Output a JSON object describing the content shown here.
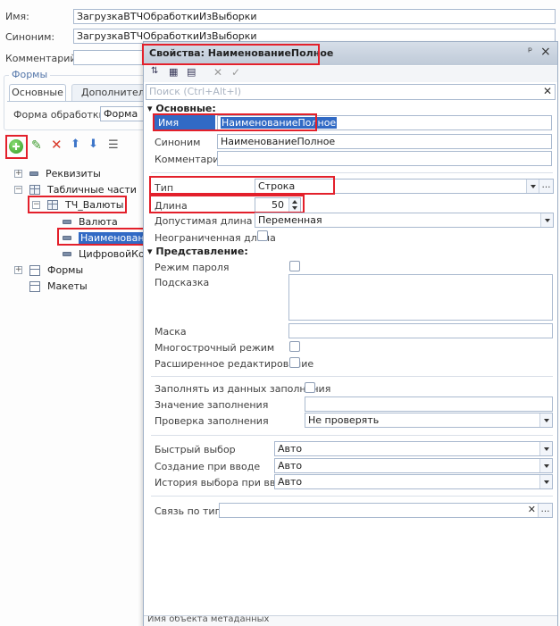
{
  "main_form": {
    "name_label": "Имя:",
    "name_value": "ЗагрузкаВТЧОбработкиИзВыборки",
    "synonym_label": "Синоним:",
    "synonym_value": "ЗагрузкаВТЧОбработкиИзВыборки",
    "comment_label": "Комментарий:",
    "comment_value": "",
    "forms_group_label": "Формы",
    "tabs": [
      {
        "label": "Основные",
        "active": true
      },
      {
        "label": "Дополнитель",
        "active": false
      }
    ],
    "form_label": "Форма обработки:",
    "form_value": "Форма"
  },
  "tree": {
    "items": [
      {
        "label": "Реквизиты",
        "icon": "attribute-icon",
        "expander": "+"
      },
      {
        "label": "Табличные части",
        "icon": "table-icon",
        "expander": "−"
      },
      {
        "label": "ТЧ_Валюты",
        "icon": "table-icon",
        "expander": "−"
      },
      {
        "label": "Валюта",
        "icon": "attribute-icon"
      },
      {
        "label": "Наименование",
        "icon": "attribute-icon",
        "selected": true
      },
      {
        "label": "ЦифровойКод",
        "icon": "attribute-icon"
      },
      {
        "label": "Формы",
        "icon": "form-icon",
        "expander": "+"
      },
      {
        "label": "Макеты",
        "icon": "template-icon"
      }
    ]
  },
  "properties": {
    "title": "Свойства: НаименованиеПолное",
    "pin_glyph": "ᵖ",
    "close_glyph": "×",
    "search_placeholder": "Поиск (Ctrl+Alt+I)",
    "section_main": "Основные:",
    "name_label": "Имя",
    "name_value": "НаименованиеПолное",
    "synonym_label": "Синоним",
    "synonym_value": "НаименованиеПолное",
    "comment_label": "Комментарий",
    "comment_value": "",
    "type_label": "Тип",
    "type_value": "Строка",
    "length_label": "Длина",
    "length_value": "50",
    "allowed_length_label": "Допустимая длина",
    "allowed_length_value": "Переменная",
    "unlimited_length_label": "Неограниченная длина",
    "section_view": "Представление:",
    "password_mode_label": "Режим пароля",
    "hint_label": "Подсказка",
    "mask_label": "Маска",
    "multiline_label": "Многострочный режим",
    "extended_edit_label": "Расширенное редактирование",
    "fill_from_data_label": "Заполнять из данных заполнения",
    "fill_value_label": "Значение заполнения",
    "fill_check_label": "Проверка заполнения",
    "fill_check_value": "Не проверять",
    "quick_choice_label": "Быстрый выбор",
    "quick_choice_value": "Авто",
    "create_on_input_label": "Создание при вводе",
    "create_on_input_value": "Авто",
    "choice_history_label": "История выбора при вводе",
    "choice_history_value": "Авто",
    "link_by_type_label": "Связь по типу",
    "bottom_text": "Имя объекта метаданных"
  },
  "colors": {
    "highlight_red": "#e3202b",
    "selection_blue": "#316ac5",
    "title_bar": "#c9d3df"
  }
}
